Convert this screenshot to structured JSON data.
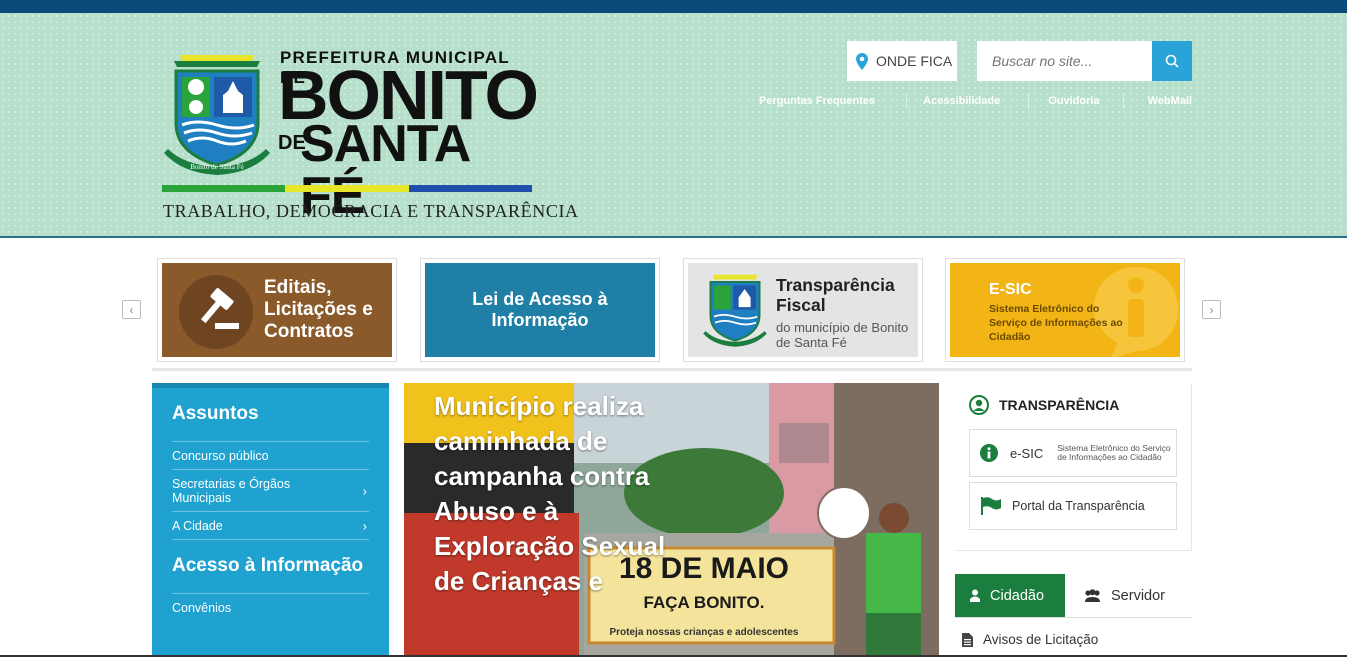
{
  "header": {
    "logo": {
      "line1": "PREFEITURA MUNICIPAL DE",
      "line2": "BONITO",
      "de": "DE",
      "line3": "SANTA FÉ",
      "tagline": "TRABALHO, DEMOCRACIA E TRANSPARÊNCIA",
      "crest_ribbon": "Bonito de Santa Fé",
      "stripe_colors": [
        "#2aa33a",
        "#e8e62a",
        "#1f4fa8"
      ]
    },
    "onde_fica": "ONDE FICA",
    "search_placeholder": "Buscar no site...",
    "quick_links": [
      "Perguntas Frequentes",
      "Acessibilidade",
      "Ouvidoria",
      "WebMail"
    ]
  },
  "banners": [
    {
      "title": "Editais, Licitações e Contratos",
      "color": "#8a5a2b"
    },
    {
      "title": "Lei de Acesso à Informação",
      "color": "#1f7fa6"
    },
    {
      "title": "Transparência Fiscal",
      "subtitle": "do município de Bonito de Santa Fé",
      "color": "#e4e4e4"
    },
    {
      "title": "E-SIC",
      "subtitle": "Sistema Eletrônico do Serviço de Informações ao Cidadão",
      "color": "#f3b515"
    }
  ],
  "sidebar": {
    "heading1": "Assuntos",
    "items1": [
      {
        "label": "Concurso público",
        "arrow": false
      },
      {
        "label": "Secretarias e Órgãos Municipais",
        "arrow": true
      },
      {
        "label": "A Cidade",
        "arrow": true
      }
    ],
    "heading2": "Acesso à Informação",
    "items2": [
      {
        "label": "Convênios",
        "arrow": false
      }
    ]
  },
  "news": {
    "title": "Município realiza caminhada de campanha contra Abuso e à Exploração Sexual de Crianças e",
    "banner_text": "18 DE MAIO",
    "banner_sub": "FAÇA BONITO.",
    "banner_footer": "Proteja nossas crianças e adolescentes"
  },
  "transparencia": {
    "heading": "TRANSPARÊNCIA",
    "esic_label": "e-SIC",
    "esic_desc": "Sistema Eletrônico do Serviço de Informações ao Cidadão",
    "portal_label": "Portal da Transparência"
  },
  "tabs": {
    "cidadao": "Cidadão",
    "servidor": "Servidor"
  },
  "list": {
    "first_item": "Avisos de Licitação"
  },
  "colors": {
    "topbar": "#0c4a7a",
    "header_bg": "#b6e0cb",
    "search_btn": "#2aa3d8",
    "sidebar_bg": "#1fa2d0",
    "tab_active": "#1b7d3e"
  }
}
